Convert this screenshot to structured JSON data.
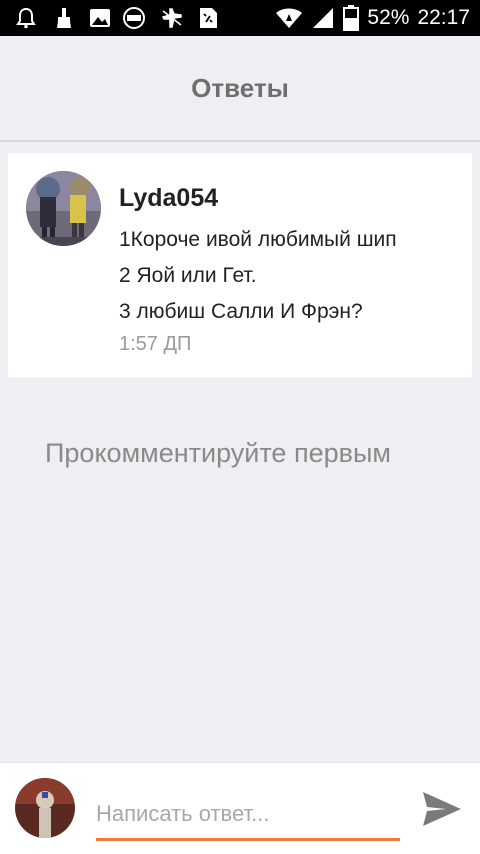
{
  "status_bar": {
    "battery": "52%",
    "time": "22:17",
    "icons": [
      "bell-icon",
      "brush-icon",
      "image-icon",
      "free-badge-icon",
      "airplane-icon",
      "sim-icon",
      "wifi-icon",
      "signal-icon",
      "battery-icon"
    ]
  },
  "header": {
    "title": "Ответы"
  },
  "comment": {
    "author": "Lyda054",
    "lines": [
      "1Короче ивой любимый шип",
      "2 Яой или Гет.",
      "3 любиш Салли И Фрэн?"
    ],
    "time": "1:57 ДП"
  },
  "empty_state": {
    "text": "Прокомментируйте первым"
  },
  "composer": {
    "placeholder": "Написать ответ..."
  },
  "colors": {
    "accent": "#f07a3a",
    "background": "#efeef2",
    "title": "#6f6f6f",
    "send_icon": "#7a7a7a"
  }
}
